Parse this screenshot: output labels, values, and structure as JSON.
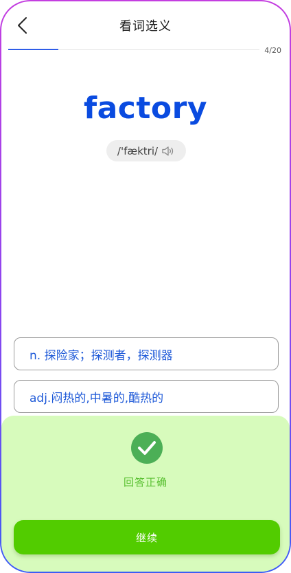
{
  "header": {
    "title": "看词选义",
    "back_icon": "chevron-left-icon"
  },
  "progress": {
    "current": 4,
    "total": 20,
    "label": "4/20",
    "fraction": 0.2,
    "fill_color": "#2f5de8"
  },
  "word": {
    "text": "factory",
    "phonetic": "/'fæktri/",
    "audio_icon": "speaker-icon",
    "color": "#0a4be0"
  },
  "options": [
    {
      "label": "n. 探险家；探测者，探测器"
    },
    {
      "label": "adj.闷热的,中暑的,酷热的"
    }
  ],
  "result": {
    "icon": "check-circle-icon",
    "text": "回答正确",
    "panel_color": "#d7fbbc",
    "icon_color": "#4caf56"
  },
  "actions": {
    "continue_label": "继续",
    "continue_color": "#52cc00"
  }
}
